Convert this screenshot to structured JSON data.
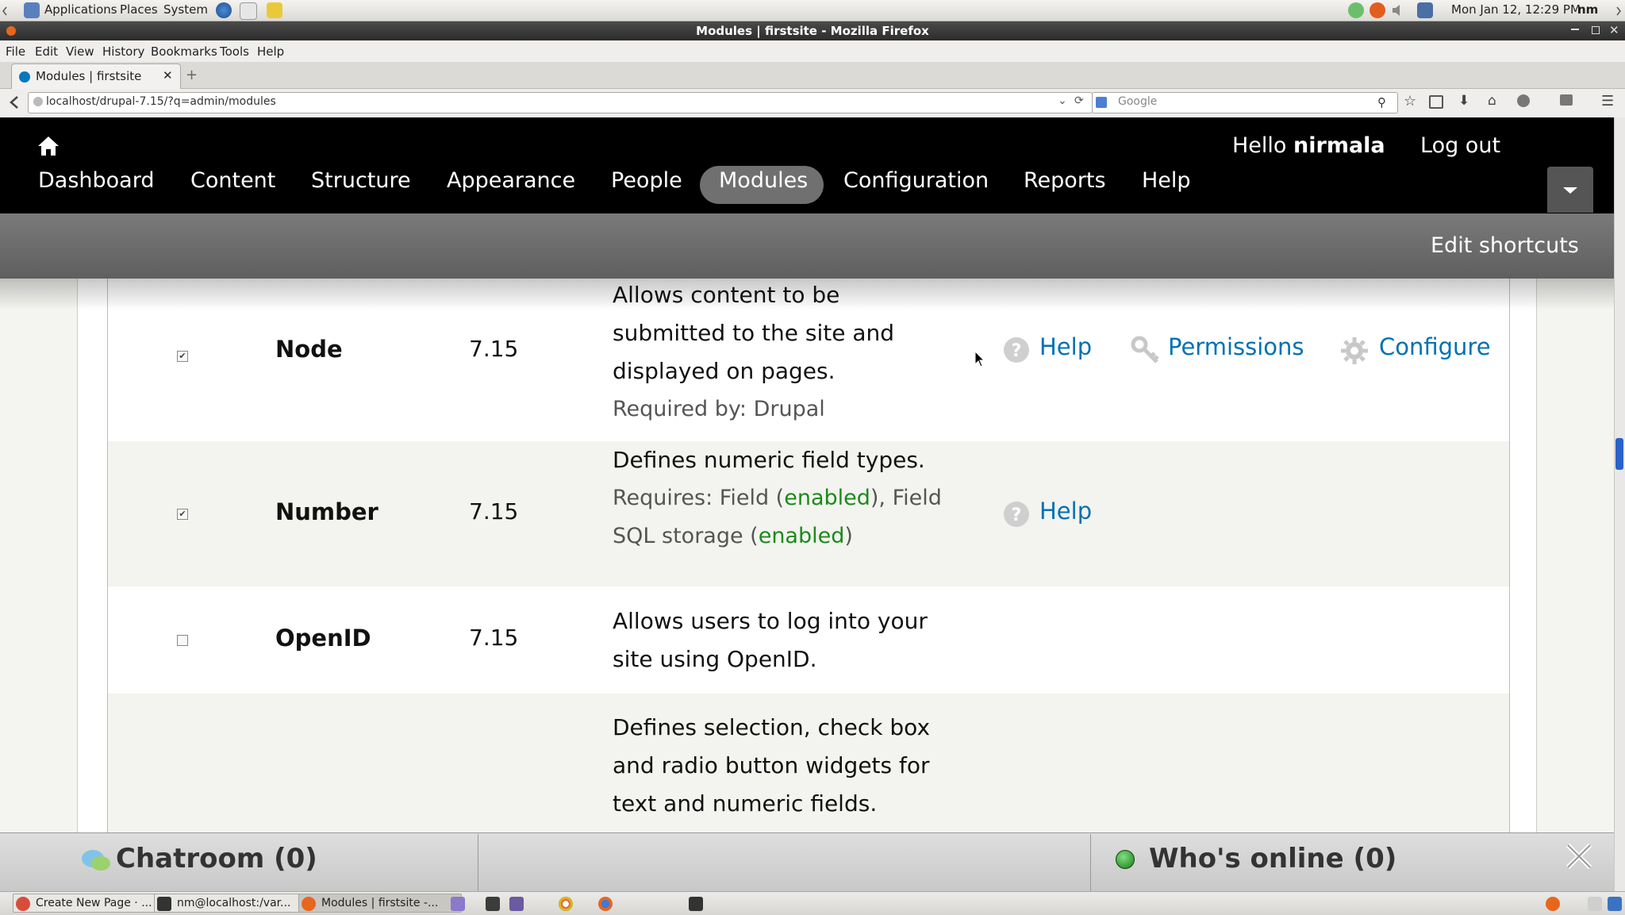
{
  "panel": {
    "applications": "Applications",
    "places": "Places",
    "system": "System",
    "clock": "Mon Jan 12, 12:29 PM",
    "user": "nm"
  },
  "window": {
    "title": "Modules | firstsite - Mozilla Firefox"
  },
  "menubar": [
    "File",
    "Edit",
    "View",
    "History",
    "Bookmarks",
    "Tools",
    "Help"
  ],
  "tab": {
    "label": "Modules | firstsite"
  },
  "urlbar": {
    "url": "localhost/drupal-7.15/?q=admin/modules",
    "search_placeholder": "Google"
  },
  "drupal": {
    "greeting": "Hello ",
    "username": "nirmala",
    "logout": "Log out",
    "nav": [
      "Dashboard",
      "Content",
      "Structure",
      "Appearance",
      "People",
      "Modules",
      "Configuration",
      "Reports",
      "Help"
    ],
    "active_nav": "Modules",
    "edit_shortcuts": "Edit shortcuts"
  },
  "modules": [
    {
      "name": "Node",
      "version": "7.15",
      "enabled": true,
      "description": "Allows content to be submitted to the site and displayed on pages.",
      "required_by": "Required by: Drupal",
      "links": [
        "Help",
        "Permissions",
        "Configure"
      ]
    },
    {
      "name": "Number",
      "version": "7.15",
      "enabled": true,
      "description": "Defines numeric field types.",
      "requires_prefix": "Requires: Field (",
      "requires_enabled1": "enabled",
      "requires_mid": "), Field SQL storage (",
      "requires_enabled2": "enabled",
      "requires_suffix": ")",
      "links": [
        "Help"
      ]
    },
    {
      "name": "OpenID",
      "version": "7.15",
      "enabled": false,
      "description": "Allows users to log into your site using OpenID."
    },
    {
      "name": "",
      "version": "",
      "enabled": false,
      "description": "Defines selection, check box and radio button widgets for text and numeric fields."
    }
  ],
  "chat": {
    "chatroom": "Chatroom (0)",
    "whos_online": "Who's online (0)"
  },
  "taskbar": [
    {
      "label": "Create New Page · ..."
    },
    {
      "label": "nm@localhost:/var..."
    },
    {
      "label": "Modules | firstsite -..."
    }
  ],
  "colors": {
    "link": "#0071b3",
    "enabled": "#1b8a1b",
    "toolbar": "#000000",
    "active_pill": "#707070"
  }
}
